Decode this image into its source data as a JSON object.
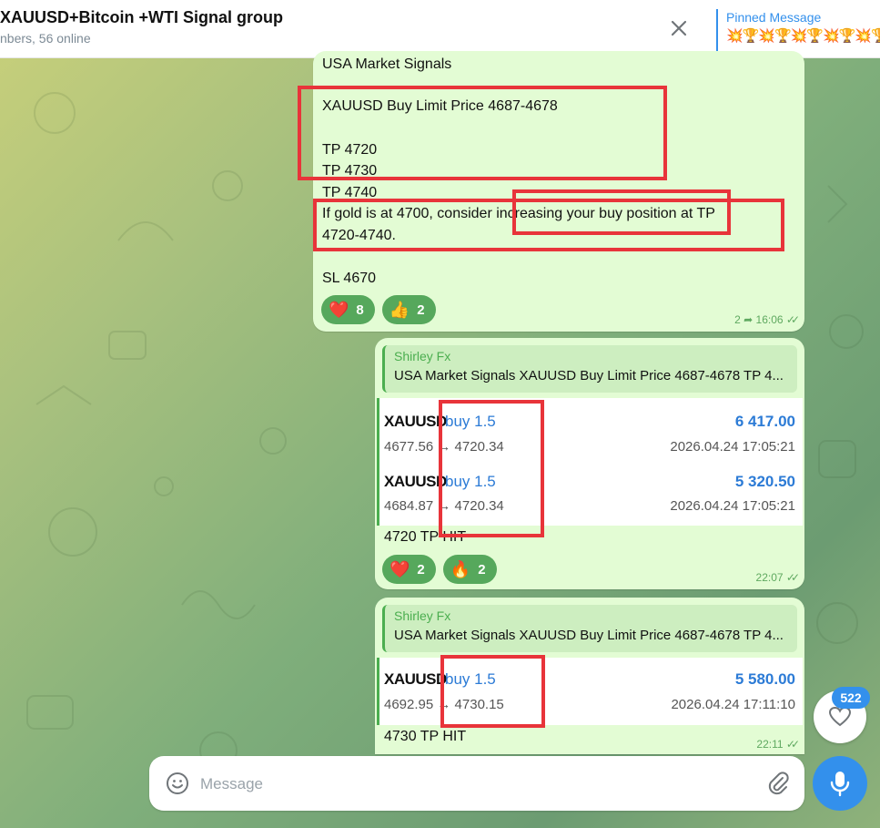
{
  "header": {
    "title": "XAUUSD+Bitcoin +WTI Signal group",
    "subtitle": "nbers, 56 online",
    "pinned_label": "Pinned Message",
    "pinned_text": "💥🏆💥🏆💥🏆💥🏆💥🏆"
  },
  "message1": {
    "lines": [
      "USA Market Signals",
      "XAUUSD Buy Limit Price 4687-4678",
      "TP 4720",
      "TP 4730",
      "TP 4740",
      "If gold is at 4700, consider increasing your buy position at TP",
      "4720-4740.",
      "SL 4670"
    ],
    "reactions": [
      {
        "emoji": "❤️",
        "count": "8"
      },
      {
        "emoji": "👍",
        "count": "2"
      }
    ],
    "replies": "2",
    "time": "16:06"
  },
  "message2": {
    "reply_name": "Shirley Fx",
    "reply_text": "USA Market Signals XAUUSD Buy Limit Price 4687-4678 TP 4...",
    "trades": [
      {
        "symbol": "XAUUSD",
        "type": "buy 1.5",
        "profit": "6 417.00",
        "prices": "4677.56 → 4720.34",
        "date": "2026.04.24 17:05:21"
      },
      {
        "symbol": "XAUUSD",
        "type": "buy 1.5",
        "profit": "5 320.50",
        "prices": "4684.87 → 4720.34",
        "date": "2026.04.24 17:05:21"
      }
    ],
    "caption": "4720 TP  HIT",
    "reactions": [
      {
        "emoji": "❤️",
        "count": "2"
      },
      {
        "emoji": "🔥",
        "count": "2"
      }
    ],
    "time": "22:07"
  },
  "message3": {
    "reply_name": "Shirley Fx",
    "reply_text": "USA Market Signals XAUUSD Buy Limit Price 4687-4678 TP 4...",
    "trades": [
      {
        "symbol": "XAUUSD",
        "type": "buy 1.5",
        "profit": "5 580.00",
        "prices": "4692.95 → 4730.15",
        "date": "2026.04.24 17:11:10"
      }
    ],
    "caption": "4730 TP  HIT",
    "time": "22:11"
  },
  "unread_count": "522",
  "composer": {
    "placeholder": "Message"
  },
  "colors": {
    "accent": "#3390ec",
    "bubble": "#e3fcd4",
    "reaction": "#56a85c",
    "highlight_box": "#e8343a",
    "profit": "#2c7bd6"
  },
  "icons": [
    "close-icon",
    "heart-icon",
    "emoji-icon",
    "attach-icon",
    "mic-icon",
    "reply-arrow-icon",
    "read-check-icon"
  ]
}
